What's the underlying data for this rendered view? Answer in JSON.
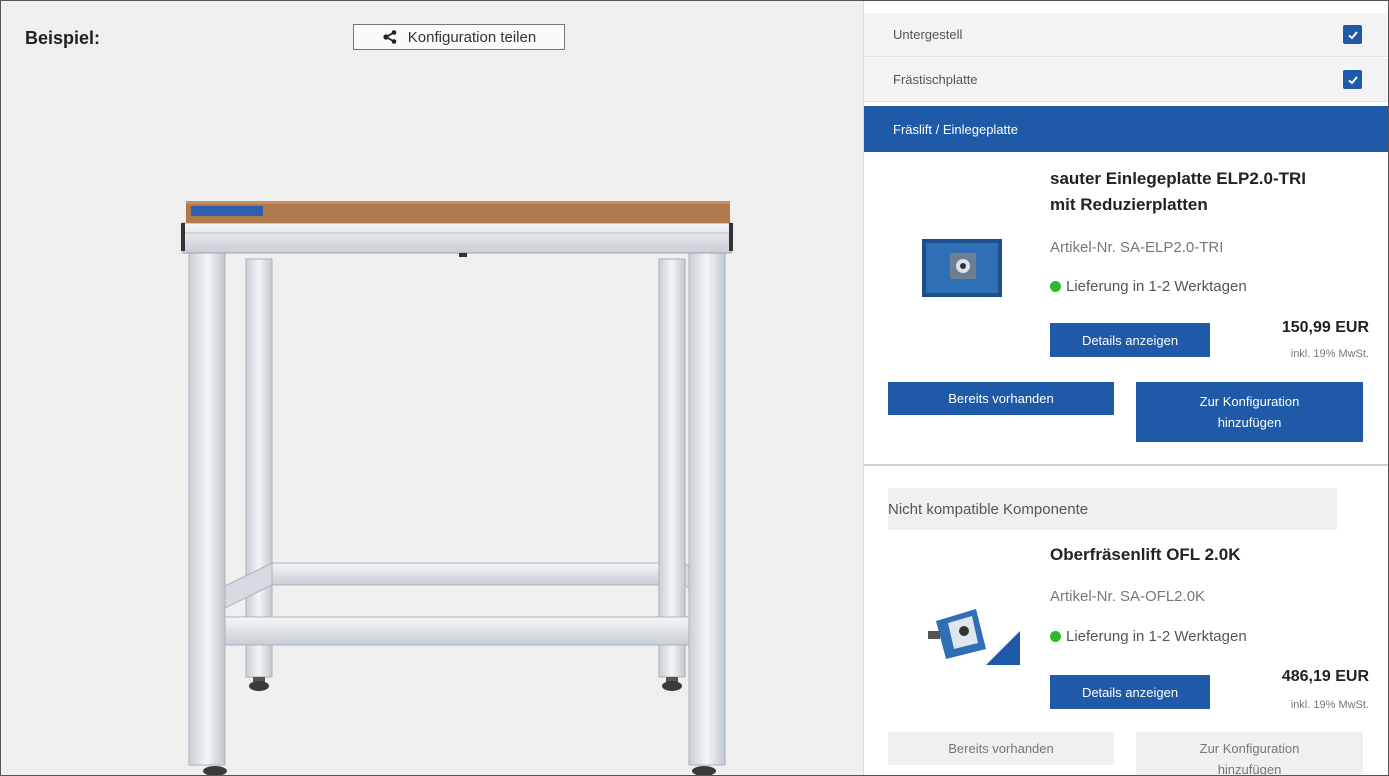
{
  "preview": {
    "label": "Beispiel:",
    "share_label": "Konfiguration teilen",
    "icon": "share-icon"
  },
  "accordion": [
    {
      "label": "Untergestell",
      "checked": true
    },
    {
      "label": "Frästischplatte",
      "checked": true
    },
    {
      "label": "Fräslift / Einlegeplatte",
      "active": true
    }
  ],
  "products": [
    {
      "title_line1": "sauter Einlegeplatte ELP2.0-TRI",
      "title_line2": "mit Reduzierplatten",
      "sku": "Artikel-Nr. SA-ELP2.0-TRI",
      "stock": "Lieferung in 1-2 Werktagen",
      "details_label": "Details anzeigen",
      "price": "150,99 EUR",
      "vat": "inkl. 19% MwSt.",
      "owned_label": "Bereits vorhanden",
      "add_label_line1": "Zur Konfiguration",
      "add_label_line2": "hinzufügen"
    },
    {
      "notice": "Nicht kompatible Komponente",
      "title_line1": "Oberfräsenlift OFL 2.0K",
      "sku": "Artikel-Nr. SA-OFL2.0K",
      "stock": "Lieferung in 1-2 Werktagen",
      "details_label": "Details anzeigen",
      "price": "486,19 EUR",
      "vat": "inkl. 19% MwSt.",
      "owned_label": "Bereits vorhanden",
      "add_label_line1": "Zur Konfiguration",
      "add_label_line2": "hinzufügen"
    }
  ],
  "colors": {
    "primary": "#1e5aa8",
    "stock_green": "#2eb82e"
  }
}
